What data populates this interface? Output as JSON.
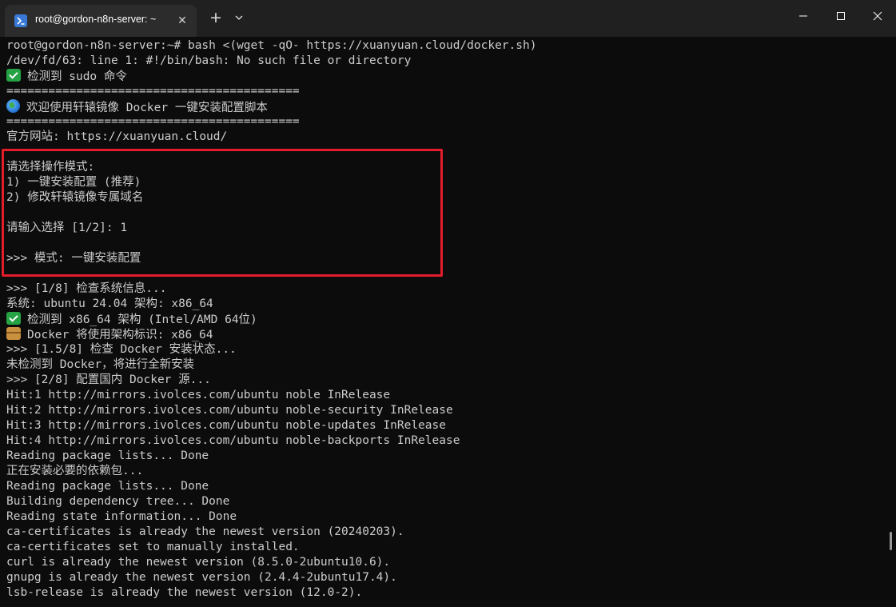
{
  "window": {
    "tab_title": "root@gordon-n8n-server: ~",
    "tab_icon": "terminal-icon",
    "new_tab_label": "+",
    "close_tab_label": "✕"
  },
  "colors": {
    "highlight_border": "#e31d2b",
    "terminal_bg": "#0c0c0c",
    "terminal_fg": "#cccccc",
    "titlebar_bg": "#202020"
  },
  "terminal": {
    "lines": [
      "root@gordon-n8n-server:~# bash <(wget -qO- https://xuanyuan.cloud/docker.sh)",
      "/dev/fd/63: line 1: #!/bin/bash: No such file or directory",
      "检测到 sudo 命令",
      "==========================================",
      "欢迎使用轩辕镜像 Docker 一键安装配置脚本",
      "==========================================",
      "官方网站: https://xuanyuan.cloud/",
      "",
      "请选择操作模式:",
      "1) 一键安装配置 (推荐)",
      "2) 修改轩辕镜像专属域名",
      "",
      "请输入选择 [1/2]: 1",
      "",
      ">>> 模式: 一键安装配置",
      "",
      ">>> [1/8] 检查系统信息...",
      "系统: ubuntu 24.04 架构: x86_64",
      "检测到 x86_64 架构 (Intel/AMD 64位)",
      "Docker 将使用架构标识: x86_64",
      ">>> [1.5/8] 检查 Docker 安装状态...",
      "未检测到 Docker，将进行全新安装",
      ">>> [2/8] 配置国内 Docker 源...",
      "Hit:1 http://mirrors.ivolces.com/ubuntu noble InRelease",
      "Hit:2 http://mirrors.ivolces.com/ubuntu noble-security InRelease",
      "Hit:3 http://mirrors.ivolces.com/ubuntu noble-updates InRelease",
      "Hit:4 http://mirrors.ivolces.com/ubuntu noble-backports InRelease",
      "Reading package lists... Done",
      "正在安装必要的依赖包...",
      "Reading package lists... Done",
      "Building dependency tree... Done",
      "Reading state information... Done",
      "ca-certificates is already the newest version (20240203).",
      "ca-certificates set to manually installed.",
      "curl is already the newest version (8.5.0-2ubuntu10.6).",
      "gnupg is already the newest version (2.4.4-2ubuntu17.4).",
      "lsb-release is already the newest version (12.0-2)."
    ],
    "line_icons": {
      "2": "check-mark-icon",
      "4": "globe-icon",
      "18": "check-mark-icon",
      "19": "package-icon"
    }
  }
}
